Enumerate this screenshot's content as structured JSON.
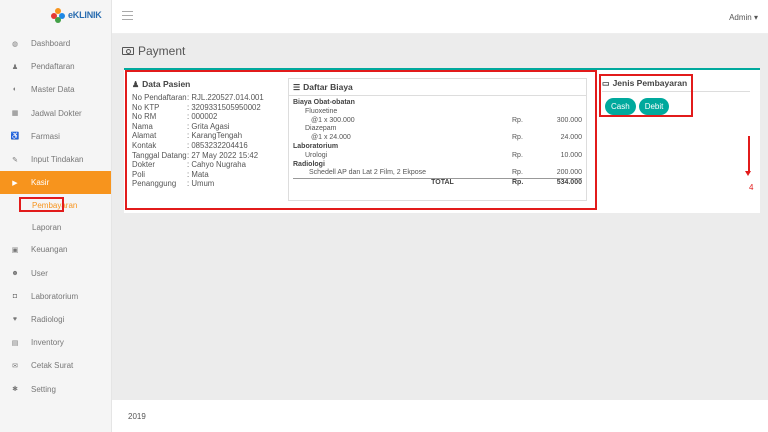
{
  "app": {
    "name": "eKLINIK"
  },
  "topbar": {
    "user": "Admin ▾"
  },
  "sidebar": {
    "items": [
      {
        "label": "Dashboard",
        "icon": "◍"
      },
      {
        "label": "Pendaftaran",
        "icon": "♟"
      },
      {
        "label": "Master Data",
        "icon": "◐"
      },
      {
        "label": "Jadwal Dokter",
        "icon": "▦"
      },
      {
        "label": "Farmasi",
        "icon": "♿"
      },
      {
        "label": "Input Tindakan",
        "icon": "✎"
      },
      {
        "label": "Kasir",
        "icon": "▶"
      }
    ],
    "sub_items": [
      {
        "label": "Pembayaran"
      },
      {
        "label": "Laporan"
      }
    ],
    "items2": [
      {
        "label": "Keuangan",
        "icon": "▣"
      },
      {
        "label": "User",
        "icon": "☻"
      },
      {
        "label": "Laboratorium",
        "icon": "◘"
      },
      {
        "label": "Radiologi",
        "icon": "♥"
      },
      {
        "label": "Inventory",
        "icon": "▤"
      },
      {
        "label": "Cetak Surat",
        "icon": "✉"
      },
      {
        "label": "Setting",
        "icon": "✱"
      }
    ]
  },
  "page": {
    "title": "Payment"
  },
  "pasien": {
    "title": "Data Pasien",
    "rows": [
      {
        "k": "No Pendaftaran",
        "v": ": RJL.220527.014.001"
      },
      {
        "k": "No KTP",
        "v": ": 3209331505950002"
      },
      {
        "k": "No RM",
        "v": ": 000002"
      },
      {
        "k": "Nama",
        "v": ": Grita Agasi"
      },
      {
        "k": "Alamat",
        "v": ": KarangTengah"
      },
      {
        "k": "Kontak",
        "v": ": 0853232204416"
      },
      {
        "k": "Tanggal Datang",
        "v": ": 27 May 2022 15:42"
      },
      {
        "k": "Dokter",
        "v": ": Cahyo Nugraha"
      },
      {
        "k": "Poli",
        "v": ": Mata"
      },
      {
        "k": "Penanggung",
        "v": ": Umum"
      }
    ]
  },
  "biaya": {
    "title": "Daftar Biaya",
    "g1": "Biaya Obat-obatan",
    "i1": "Fluoxetine",
    "i1d": "@1 x 300.000",
    "i1rp": "Rp.",
    "i1v": "300.000",
    "i2": "Diazepam",
    "i2d": "@1 x 24.000",
    "i2rp": "Rp.",
    "i2v": "24.000",
    "g2": "Laboratorium",
    "i3": "Urologi",
    "i3rp": "Rp.",
    "i3v": "10.000",
    "g3": "Radiologi",
    "i4": "Schedell AP dan Lat 2 Film, 2 Ekpose",
    "i4rp": "Rp.",
    "i4v": "200.000",
    "total_label": "TOTAL",
    "total_rp": "Rp.",
    "total_v": "534.000"
  },
  "pembayaran": {
    "title": "Jenis Pembayaran",
    "cash": "Cash",
    "debit": "Debit"
  },
  "annotation": {
    "step": "4"
  },
  "footer": {
    "year": "2019"
  },
  "colors": {
    "accent": "#f7941d",
    "teal": "#00a99d",
    "annot": "#e21b1b"
  }
}
